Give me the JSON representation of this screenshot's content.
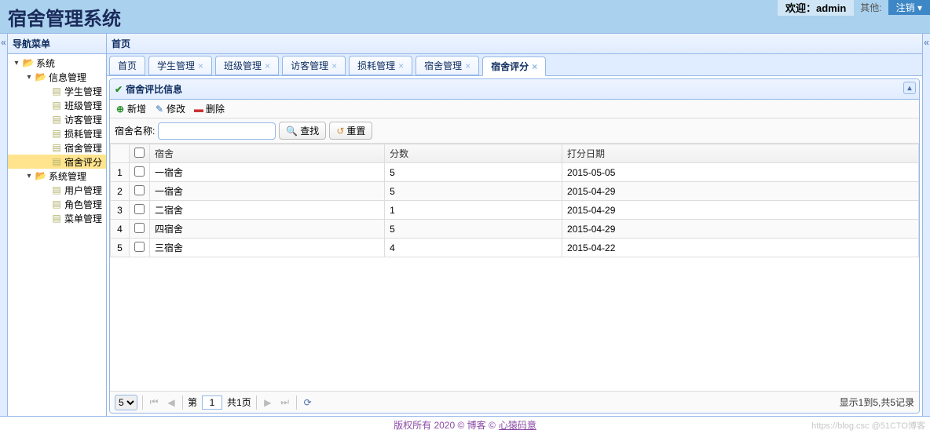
{
  "banner": {
    "title": "宿舍管理系统",
    "welcome": "欢迎：admin",
    "other": "其他:",
    "logout": "注销 ▾"
  },
  "sidebar": {
    "title": "导航菜单",
    "nodes": [
      {
        "label": "系统",
        "level": 1,
        "icon": "folder",
        "expanded": true
      },
      {
        "label": "信息管理",
        "level": 2,
        "icon": "folder",
        "expanded": true
      },
      {
        "label": "学生管理",
        "level": 3,
        "icon": "page"
      },
      {
        "label": "班级管理",
        "level": 3,
        "icon": "page"
      },
      {
        "label": "访客管理",
        "level": 3,
        "icon": "page"
      },
      {
        "label": "损耗管理",
        "level": 3,
        "icon": "page"
      },
      {
        "label": "宿舍管理",
        "level": 3,
        "icon": "page"
      },
      {
        "label": "宿舍评分",
        "level": 3,
        "icon": "page",
        "selected": true
      },
      {
        "label": "系统管理",
        "level": 2,
        "icon": "folder",
        "expanded": true
      },
      {
        "label": "用户管理",
        "level": 3,
        "icon": "page"
      },
      {
        "label": "角色管理",
        "level": 3,
        "icon": "page"
      },
      {
        "label": "菜单管理",
        "level": 3,
        "icon": "page"
      }
    ]
  },
  "content": {
    "header": "首页",
    "tabs": [
      {
        "label": "首页",
        "closable": false
      },
      {
        "label": "学生管理",
        "closable": true
      },
      {
        "label": "班级管理",
        "closable": true
      },
      {
        "label": "访客管理",
        "closable": true
      },
      {
        "label": "损耗管理",
        "closable": true
      },
      {
        "label": "宿舍管理",
        "closable": true
      },
      {
        "label": "宿舍评分",
        "closable": true,
        "active": true
      }
    ],
    "panel": {
      "title": "宿舍评比信息"
    },
    "toolbar": {
      "add": "新增",
      "edit": "修改",
      "del": "删除"
    },
    "search": {
      "label": "宿舍名称:",
      "value": "",
      "findBtn": "查找",
      "resetBtn": "重置"
    },
    "grid": {
      "columns": [
        "宿舍",
        "分数",
        "打分日期"
      ],
      "rows": [
        {
          "n": 1,
          "dorm": "一宿舍",
          "score": "5",
          "date": "2015-05-05"
        },
        {
          "n": 2,
          "dorm": "一宿舍",
          "score": "5",
          "date": "2015-04-29"
        },
        {
          "n": 3,
          "dorm": "二宿舍",
          "score": "1",
          "date": "2015-04-29"
        },
        {
          "n": 4,
          "dorm": "四宿舍",
          "score": "5",
          "date": "2015-04-29"
        },
        {
          "n": 5,
          "dorm": "三宿舍",
          "score": "4",
          "date": "2015-04-22"
        }
      ]
    },
    "pager": {
      "pageSize": "5",
      "pagePrefix": "第",
      "page": "1",
      "pageSuffix": "共1页",
      "info": "显示1到5,共5记录"
    }
  },
  "footer": {
    "text": "版权所有 2020 © 博客 © ",
    "link": "心猿码意",
    "watermark": "https://blog.csc @51CTO博客"
  }
}
